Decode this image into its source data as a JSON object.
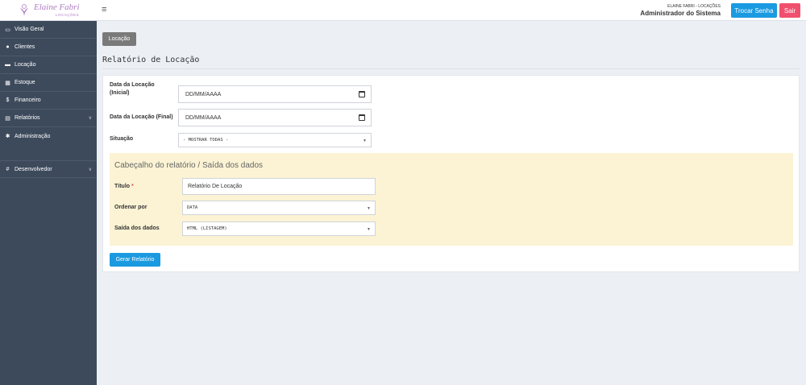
{
  "header": {
    "logo_name": "Elaine Fabri",
    "logo_sub": "LOCAÇÕES",
    "menu_icon": "hamburger-icon",
    "user_company": "ELAINE FABRI - LOCAÇÕES",
    "user_role": "Administrador do Sistema",
    "change_password_label": "Trocar Senha",
    "logout_label": "Sair"
  },
  "sidebar": {
    "items": [
      {
        "label": "Visão Geral",
        "icon": "monitor-icon"
      },
      {
        "label": "Clientes",
        "icon": "users-icon"
      },
      {
        "label": "Locação",
        "icon": "box-icon"
      },
      {
        "label": "Estoque",
        "icon": "grid-icon"
      },
      {
        "label": "Financeiro",
        "icon": "dollar-icon"
      },
      {
        "label": "Relatórios",
        "icon": "printer-icon"
      },
      {
        "label": "Administração",
        "icon": "gear-icon"
      },
      {
        "label": "Desenvolvedor",
        "icon": "hash-icon"
      }
    ]
  },
  "content": {
    "breadcrumb": "Locação",
    "title": "Relatório de Locação",
    "form": {
      "date_start_label_1": "Data da Locação",
      "date_start_label_2": "(Inicial)",
      "date_start_placeholder": "DD/MM/AAAA",
      "date_end_label": "Data da Locação (Final)",
      "date_end_placeholder": "DD/MM/AAAA",
      "status_label": "Situação",
      "status_value": "- MOSTRAR TODAS -"
    },
    "output": {
      "section_title": "Cabeçalho do relatório / Saída dos dados",
      "title_label": "Título",
      "title_required": "*",
      "title_value": "Relatório De Locação",
      "order_label": "Ordenar por",
      "order_value": "DATA",
      "output_label": "Saída dos dados",
      "output_value": "HTML (LISTAGEM)"
    },
    "generate_label": "Gerar Relatório"
  },
  "colors": {
    "primary": "#1a9ae0",
    "danger": "#f0506e",
    "sidebar": "#3d4a5c",
    "highlight_box": "#fbf3d4"
  }
}
